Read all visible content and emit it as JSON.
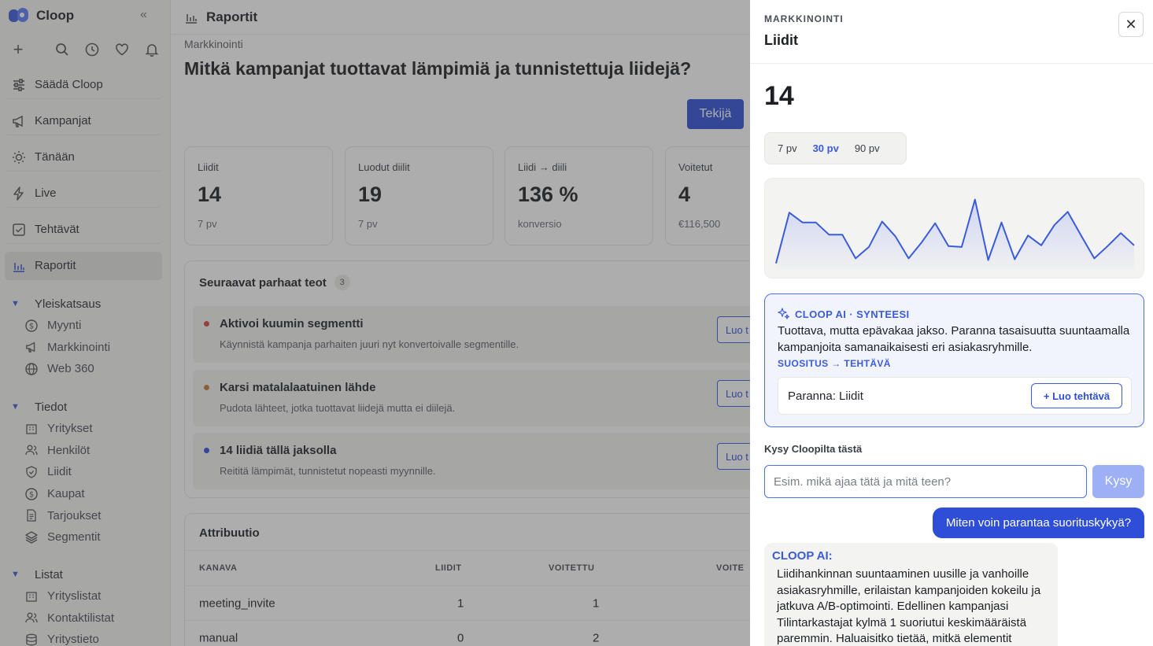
{
  "app": {
    "name": "Cloop",
    "collapse_icon": "«",
    "colors": {
      "accent": "#2f4ed8",
      "accent_light": "#9db0f5",
      "red_dot": "#d9453f",
      "orange_dot": "#c57b3a",
      "blue_dot": "#2f4ed8"
    }
  },
  "sidebar": {
    "nav": [
      {
        "label": "Säädä Cloop",
        "icon": "sliders-icon"
      },
      {
        "label": "Kampanjat",
        "icon": "megaphone-icon"
      },
      {
        "label": "Tänään",
        "icon": "sun-icon"
      },
      {
        "label": "Live",
        "icon": "bolt-icon"
      },
      {
        "label": "Tehtävät",
        "icon": "checkbox-icon"
      },
      {
        "label": "Raportit",
        "icon": "bar-chart-icon",
        "active": true
      }
    ],
    "groups": [
      {
        "title": "Yleiskatsaus",
        "items": [
          {
            "label": "Myynti",
            "icon": "dollar-icon"
          },
          {
            "label": "Markkinointi",
            "icon": "megaphone-icon"
          },
          {
            "label": "Web 360",
            "icon": "globe-icon"
          }
        ]
      },
      {
        "title": "Tiedot",
        "items": [
          {
            "label": "Yritykset",
            "icon": "building-icon"
          },
          {
            "label": "Henkilöt",
            "icon": "people-icon"
          },
          {
            "label": "Liidit",
            "icon": "shield-icon"
          },
          {
            "label": "Kaupat",
            "icon": "dollar-icon"
          },
          {
            "label": "Tarjoukset",
            "icon": "document-icon"
          },
          {
            "label": "Segmentit",
            "icon": "layers-icon"
          }
        ]
      },
      {
        "title": "Listat",
        "items": [
          {
            "label": "Yrityslistat",
            "icon": "building-icon"
          },
          {
            "label": "Kontaktilistat",
            "icon": "people-icon"
          },
          {
            "label": "Yritystieto",
            "icon": "database-icon"
          }
        ]
      }
    ]
  },
  "main": {
    "topbar_title": "Raportit",
    "breadcrumb": "Markkinointi",
    "title": "Mitkä kampanjat tuottavat lämpimiä ja tunnistettuja liidejä?",
    "author_button": "Tekijä",
    "kpis": [
      {
        "label": "Liidit",
        "value": "14",
        "sub": "7 pv"
      },
      {
        "label": "Luodut diilit",
        "value": "19",
        "sub": "7 pv"
      },
      {
        "label": "Liidi → diili",
        "value": "136 %",
        "sub": "konversio"
      },
      {
        "label": "Voitetut",
        "value": "4",
        "sub": "€116,500"
      }
    ],
    "next_actions": {
      "title": "Seuraavat parhaat teot",
      "count": "3",
      "items": [
        {
          "title": "Aktivoi kuumin segmentti",
          "desc": "Käynnistä kampanja parhaiten juuri nyt konvertoivalle segmentille.",
          "button": "Luo t",
          "dot": "red"
        },
        {
          "title": "Karsi matalalaatuinen lähde",
          "desc": "Pudota lähteet, jotka tuottavat liidejä mutta ei diilejä.",
          "button": "Luo t",
          "dot": "orange"
        },
        {
          "title": "14 liidiä tällä jaksolla",
          "desc": "Reititä lämpimät, tunnistetut nopeasti myynnille.",
          "button": "Luo t",
          "dot": "blue"
        }
      ]
    },
    "attribution": {
      "title": "Attribuutio",
      "columns": [
        "KANAVA",
        "LIIDIT",
        "VOITETTU",
        "VOITE"
      ],
      "rows": [
        [
          "meeting_invite",
          "1",
          "1"
        ],
        [
          "manual",
          "0",
          "2"
        ]
      ]
    }
  },
  "drawer": {
    "eyebrow": "MARKKINOINTI",
    "title": "Liidit",
    "close_icon": "✕",
    "value": "14",
    "ranges": [
      "7 pv",
      "30 pv",
      "90 pv"
    ],
    "selected_range": "30 pv",
    "chart_data": {
      "type": "line",
      "series": [
        {
          "values": [
            0.08,
            0.7,
            0.58,
            0.58,
            0.43,
            0.43,
            0.14,
            0.28,
            0.59,
            0.41,
            0.14,
            0.34,
            0.57,
            0.29,
            0.28,
            0.86,
            0.12,
            0.58,
            0.13,
            0.42,
            0.3,
            0.55,
            0.71,
            0.42,
            0.14,
            0.29,
            0.45,
            0.3
          ]
        }
      ]
    },
    "ai_card": {
      "head": "CLOOP AI · SYNTEESI",
      "text": "Tuottava, mutta epävakaa jakso. Paranna tasaisuutta suuntaamalla kampanjoita samanaikaisesti eri asiakasryhmille.",
      "recommendation": "SUOSITUS → TEHTÄVÄ",
      "task_label": "Paranna: Liidit",
      "task_button": "+ Luo tehtävä"
    },
    "ask": {
      "label": "Kysy Cloopilta tästä",
      "placeholder": "Esim. mikä ajaa tätä ja mitä teen?",
      "button": "Kysy"
    },
    "chat": {
      "user_message": "Miten voin parantaa suorituskykyä?",
      "ai_from": "CLOOP AI:",
      "ai_message": "Liidihankinnan suuntaaminen uusille ja vanhoille asiakasryhmille, erilaistan kampanjoiden kokeilu ja jatkuva A/B-optimointi. Edellinen kampanjasi Tilintarkastajat kylmä 1 suoriutui keskimääräistä paremmin. Haluaisitko tietää, mitkä elementit"
    }
  }
}
